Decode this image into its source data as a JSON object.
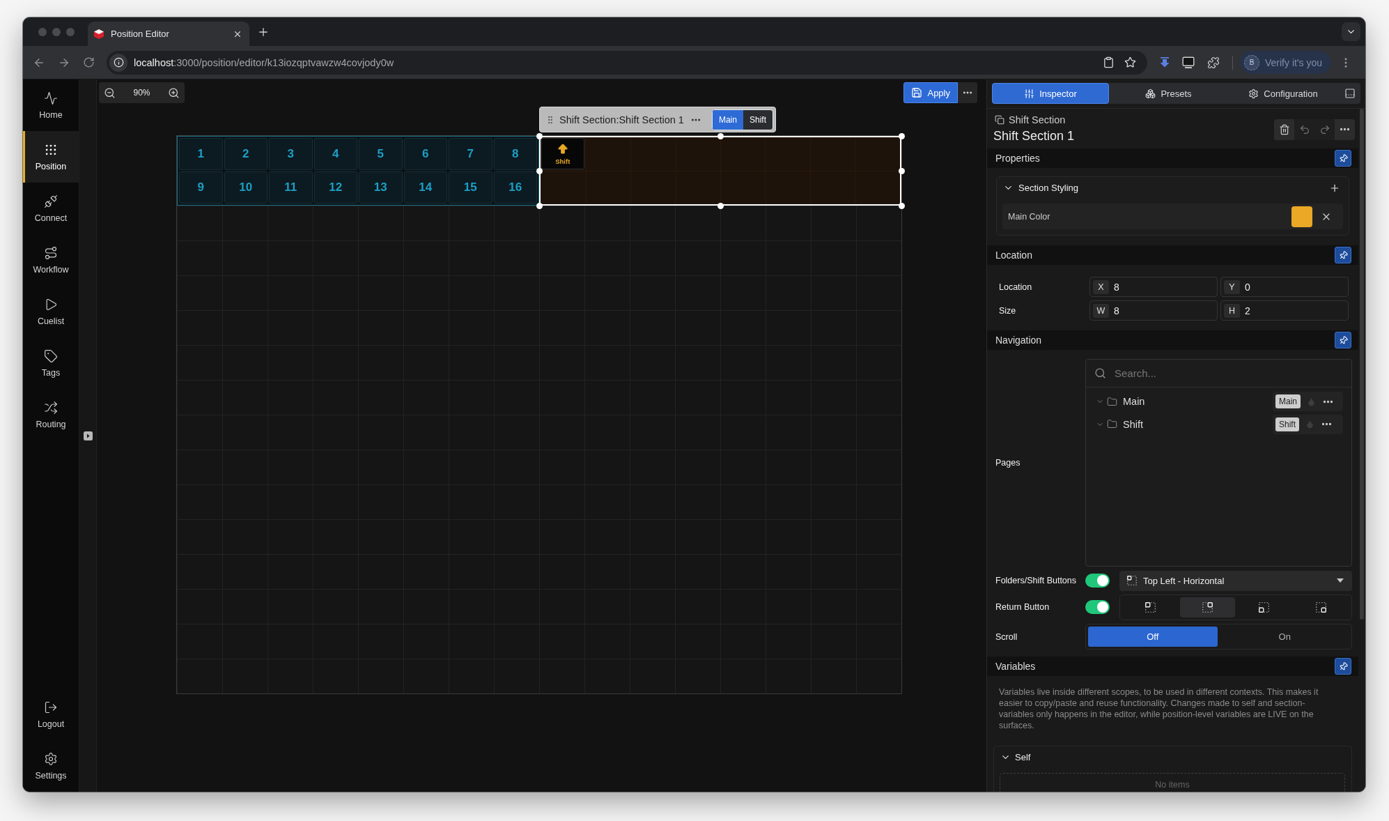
{
  "browser": {
    "tab": {
      "title": "Position Editor"
    },
    "address": {
      "host": "localhost",
      "path": ":3000/position/editor/k13iozqptvawzw4covjody0w"
    },
    "profile": {
      "avatar": "B",
      "label": "Verify it's you"
    }
  },
  "nav": {
    "items": [
      {
        "label": "Home",
        "selected": false
      },
      {
        "label": "Position",
        "selected": true
      },
      {
        "label": "Connect",
        "selected": false
      },
      {
        "label": "Workflow",
        "selected": false
      },
      {
        "label": "Cuelist",
        "selected": false
      },
      {
        "label": "Tags",
        "selected": false
      },
      {
        "label": "Routing",
        "selected": false
      }
    ],
    "footer": [
      {
        "label": "Logout"
      },
      {
        "label": "Settings"
      }
    ]
  },
  "canvas": {
    "zoom": "90%",
    "apply": "Apply",
    "buttons": [
      {
        "label": "1"
      },
      {
        "label": "2"
      },
      {
        "label": "3"
      },
      {
        "label": "4"
      },
      {
        "label": "5"
      },
      {
        "label": "6"
      },
      {
        "label": "7"
      },
      {
        "label": "8"
      },
      {
        "label": "9"
      },
      {
        "label": "10"
      },
      {
        "label": "11"
      },
      {
        "label": "12"
      },
      {
        "label": "13"
      },
      {
        "label": "14"
      },
      {
        "label": "15"
      },
      {
        "label": "16"
      }
    ],
    "section": {
      "selected": true,
      "title": "Shift Section:Shift Section 1",
      "pages": [
        {
          "label": "Main",
          "selected": true
        },
        {
          "label": "Shift",
          "selected": false
        }
      ],
      "buttons": [
        {
          "label": "Shift"
        }
      ]
    }
  },
  "inspector": {
    "tabs": [
      {
        "label": "Inspector",
        "selected": true
      },
      {
        "label": "Presets",
        "selected": false
      },
      {
        "label": "Configuration",
        "selected": false
      }
    ],
    "header": {
      "object_type": "Shift Section",
      "title": "Shift Section 1",
      "actions": [
        {
          "kind": "delete",
          "disabled": false
        },
        {
          "kind": "undo",
          "disabled": true
        },
        {
          "kind": "redo",
          "disabled": true
        },
        {
          "kind": "more",
          "disabled": false
        }
      ]
    },
    "properties": {
      "title": "Properties",
      "group": {
        "title": "Section Styling",
        "expanded": true,
        "fields": [
          {
            "label": "Main Color",
            "color": "#e9a825"
          }
        ]
      }
    },
    "location": {
      "title": "Location",
      "rows": [
        {
          "label": "Location",
          "fields": [
            {
              "axis": "X",
              "value": "8"
            },
            {
              "axis": "Y",
              "value": "0"
            }
          ]
        },
        {
          "label": "Size",
          "fields": [
            {
              "axis": "W",
              "value": "8"
            },
            {
              "axis": "H",
              "value": "2"
            }
          ]
        }
      ]
    },
    "navigation": {
      "title": "Navigation",
      "pages": {
        "label": "Pages",
        "placeholder": "Search...",
        "items": [
          {
            "name": "Main",
            "tag": "Main"
          },
          {
            "name": "Shift",
            "tag": "Shift"
          }
        ]
      },
      "folder_buttons": {
        "label": "Folders/Shift Buttons",
        "on": true,
        "placement": "Top Left - Horizontal"
      },
      "return_button": {
        "label": "Return Button",
        "on": true,
        "positions": [
          {
            "kind": "top-left",
            "selected": false
          },
          {
            "kind": "top-right",
            "selected": true
          },
          {
            "kind": "bottom-left",
            "selected": false
          },
          {
            "kind": "bottom-right",
            "selected": false
          }
        ]
      },
      "scroll": {
        "label": "Scroll",
        "options": [
          {
            "label": "Off",
            "selected": true
          },
          {
            "label": "On",
            "selected": false
          }
        ]
      }
    },
    "variables": {
      "title": "Variables",
      "description": "Variables live inside different scopes, to be used in different contexts. This makes it easier to copy/paste and reuse functionality. Changes made to self and section-variables only happens in the editor, while position-level variables are LIVE on the surfaces.",
      "scopes": [
        {
          "title": "Self",
          "expanded": true,
          "empty": "No items"
        }
      ]
    }
  }
}
